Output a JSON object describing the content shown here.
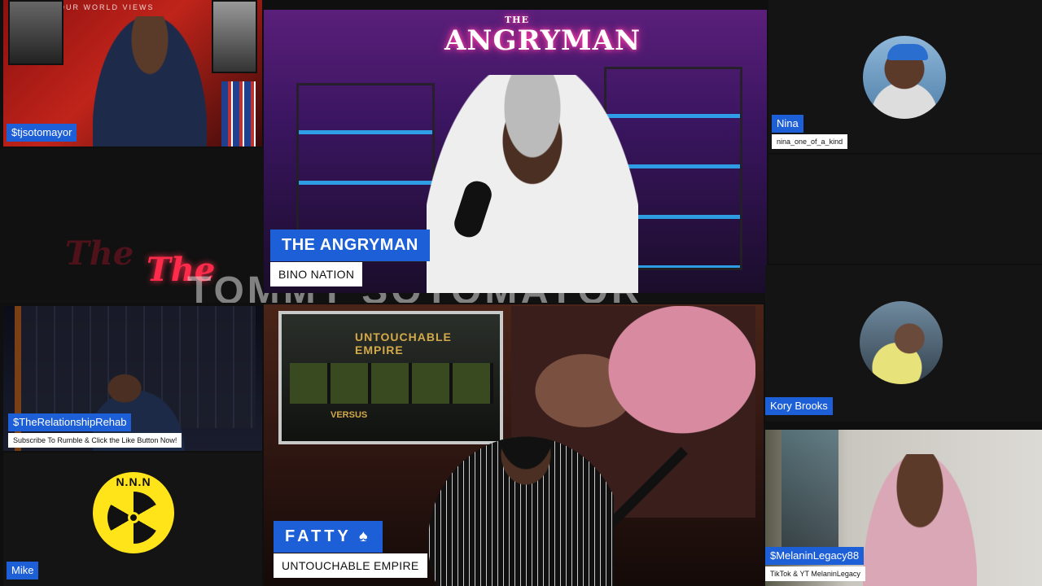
{
  "participants": {
    "host_top_left": {
      "name": "$tjsotomayor",
      "banner": "YOUR WORLD VIEWS"
    },
    "main_speaker": {
      "name": "THE ANGRYMAN",
      "subtitle": "BINO NATION",
      "logo_text": "ANGRYMAN",
      "logo_small": "THE"
    },
    "nina": {
      "name": "Nina",
      "subtitle": "nina_one_of_a_kind"
    },
    "relationship_rehab": {
      "name": "$TheRelationshipRehab",
      "subtitle": "Subscribe To Rumble & Click the Like Button Now!"
    },
    "fatty": {
      "name": "FATTY ♠",
      "subtitle": "UNTOUCHABLE EMPIRE",
      "tv_text": "UNTOUCHABLE EMPIRE",
      "tv_text2": "VERSUS"
    },
    "kory": {
      "name": "Kory Brooks"
    },
    "mike": {
      "name": "Mike",
      "logo_text": "N.N.N"
    },
    "melanin": {
      "name": "$MelaninLegacy88",
      "subtitle": "TikTok & YT MelaninLegacy"
    }
  },
  "background_watermark": {
    "script1": "The",
    "script2": "The",
    "bold": "TOMMY SOTOMAYOR"
  },
  "colors": {
    "tag_blue": "#1d5fd6",
    "tag_white": "#ffffff",
    "background": "#0f0f0f"
  }
}
